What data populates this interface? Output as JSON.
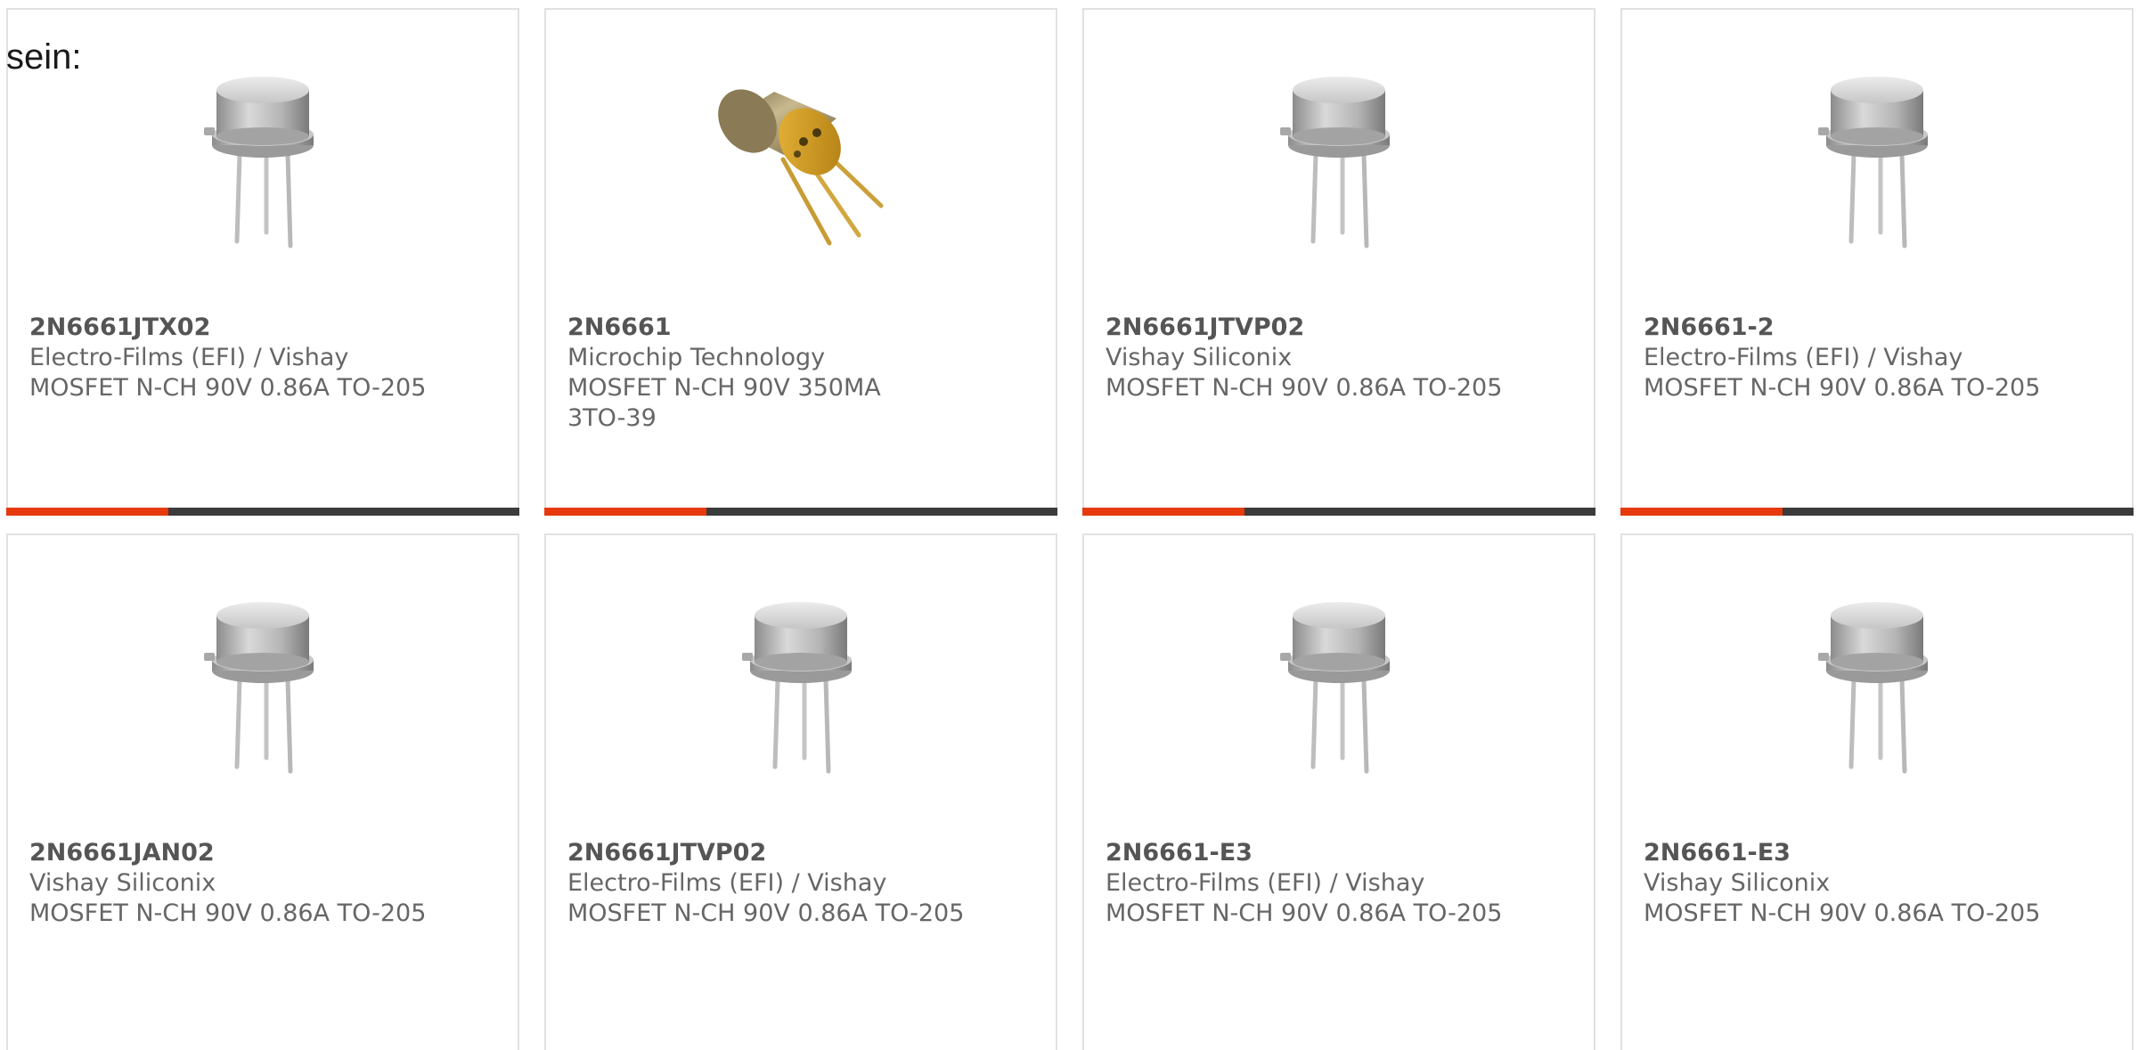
{
  "intro_text": "sein:",
  "colors": {
    "accent": "#e63a0c",
    "bar": "#3b3b3b",
    "border": "#e1e1e1",
    "text": "#666666"
  },
  "products": [
    {
      "part": "2N6661JTX02",
      "manufacturer": "Electro-Films (EFI) / Vishay",
      "description": "MOSFET N-CH 90V 0.86A TO-205",
      "image": "to205-silver-transistor-icon"
    },
    {
      "part": "2N6661",
      "manufacturer": "Microchip Technology",
      "description": "MOSFET N-CH 90V 350MA 3TO-39",
      "image": "to39-gold-transistor-icon"
    },
    {
      "part": "2N6661JTVP02",
      "manufacturer": "Vishay Siliconix",
      "description": "MOSFET N-CH 90V 0.86A TO-205",
      "image": "to205-silver-transistor-icon"
    },
    {
      "part": "2N6661-2",
      "manufacturer": "Electro-Films (EFI) / Vishay",
      "description": "MOSFET N-CH 90V 0.86A TO-205",
      "image": "to205-silver-transistor-icon"
    },
    {
      "part": "2N6661JAN02",
      "manufacturer": "Vishay Siliconix",
      "description": "MOSFET N-CH 90V 0.86A TO-205",
      "image": "to205-silver-transistor-icon"
    },
    {
      "part": "2N6661JTVP02",
      "manufacturer": "Electro-Films (EFI) / Vishay",
      "description": "MOSFET N-CH 90V 0.86A TO-205",
      "image": "to205-silver-transistor-icon"
    },
    {
      "part": "2N6661-E3",
      "manufacturer": "Electro-Films (EFI) / Vishay",
      "description": "MOSFET N-CH 90V 0.86A TO-205",
      "image": "to205-silver-transistor-icon"
    },
    {
      "part": "2N6661-E3",
      "manufacturer": "Vishay Siliconix",
      "description": "MOSFET N-CH 90V 0.86A TO-205",
      "image": "to205-silver-transistor-icon"
    }
  ]
}
